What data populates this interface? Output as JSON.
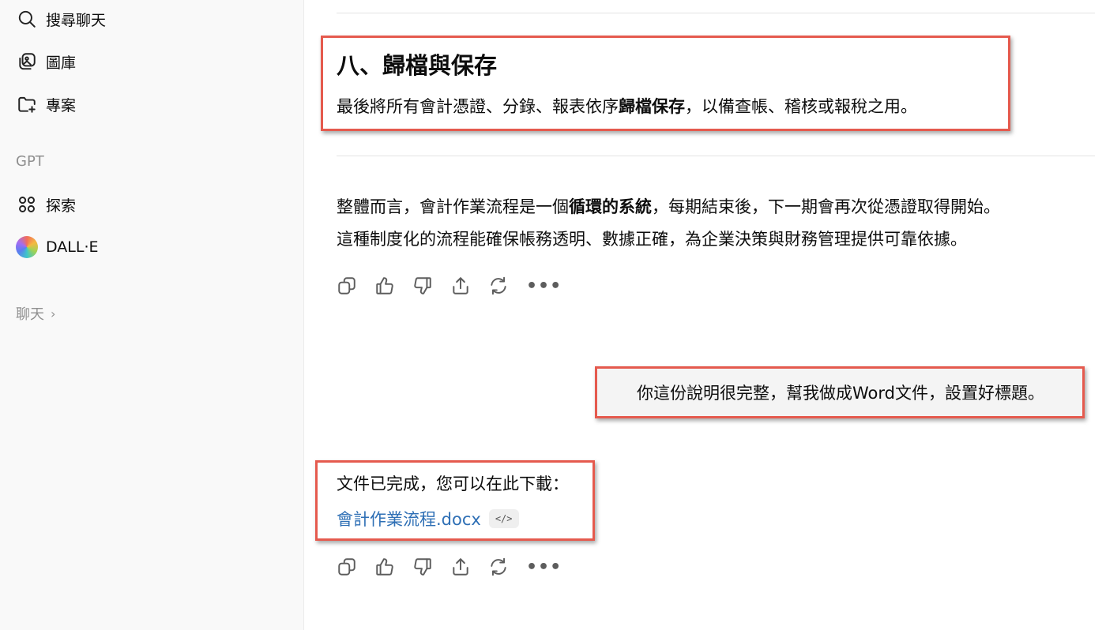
{
  "sidebar": {
    "search_label": "搜尋聊天",
    "library_label": "圖庫",
    "projects_label": "專案",
    "gpt_section": "GPT",
    "explore_label": "探索",
    "dalle_label": "DALL·E",
    "chats_label": "聊天",
    "chats_chevron": "›"
  },
  "conversation": {
    "section_title": "八、歸檔與保存",
    "section_body_pre": "最後將所有會計憑證、分錄、報表依序",
    "section_body_bold": "歸檔保存",
    "section_body_post": "，以備查帳、稽核或報稅之用。",
    "summary_line1_pre": "整體而言，會計作業流程是一個",
    "summary_line1_bold": "循環的系統",
    "summary_line1_post": "，每期結束後，下一期會再次從憑證取得開始。",
    "summary_line2": "這種制度化的流程能確保帳務透明、數據正確，為企業決策與財務管理提供可靠依據。",
    "user_message": "你這份說明很完整，幫我做成Word文件，設置好標題。",
    "reply_text": "文件已完成，您可以在此下載：",
    "file_link": "會計作業流程.docx",
    "code_chip": "</>",
    "more_dots": "•••"
  },
  "colors": {
    "highlight_box": "#e55a4e",
    "link": "#2e6fb5",
    "sidebar_bg": "#f9f9f9",
    "user_bubble": "#f4f4f4"
  },
  "icons": {
    "search": "search-icon",
    "library": "image-library-icon",
    "projects": "folder-plus-icon",
    "explore": "grid-circles-icon",
    "dalle": "dalle-orb-icon",
    "copy": "copy-icon",
    "thumbs_up": "thumbs-up-icon",
    "thumbs_down": "thumbs-down-icon",
    "share": "share-icon",
    "regenerate": "regenerate-icon",
    "more": "more-icon"
  }
}
